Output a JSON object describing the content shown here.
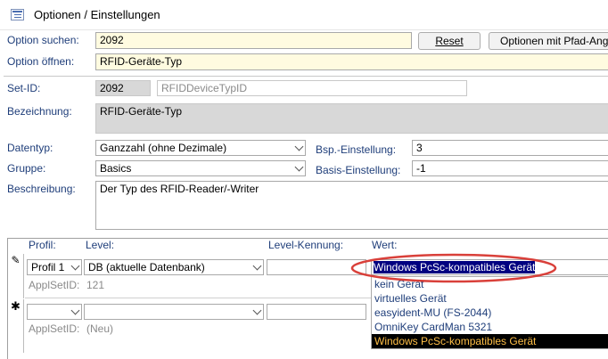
{
  "window": {
    "title": "Optionen / Einstellungen",
    "icon": "form-icon"
  },
  "search": {
    "label": "Option suchen:",
    "value": "2092",
    "reset": "Reset",
    "with_path": "Optionen mit Pfad-Ang"
  },
  "open": {
    "label": "Option öffnen:",
    "value": "RFID-Geräte-Typ"
  },
  "set": {
    "label": "Set-ID:",
    "id": "2092",
    "name": "RFIDDeviceTypID"
  },
  "bezeichnung": {
    "label": "Bezeichnung:",
    "value": "RFID-Geräte-Typ"
  },
  "datentyp": {
    "label": "Datentyp:",
    "value": "Ganzzahl (ohne Dezimale)"
  },
  "bsp": {
    "label": "Bsp.-Einstellung:",
    "value": "3"
  },
  "gruppe": {
    "label": "Gruppe:",
    "value": "Basics"
  },
  "basis": {
    "label": "Basis-Einstellung:",
    "value": "-1"
  },
  "beschreibung": {
    "label": "Beschreibung:",
    "value": "Der Typ des RFID-Reader/-Writer"
  },
  "subform": {
    "headers": {
      "profil": "Profil:",
      "level": "Level:",
      "kennung": "Level-Kennung:",
      "wert": "Wert:"
    },
    "row1": {
      "profil": "Profil 1",
      "level": "DB  (aktuelle Datenbank)",
      "kennung": "",
      "wert": "Windows PcSc-kompatibles Gerät",
      "applset_label": "ApplSetID:",
      "applset_value": "121",
      "marker": "✎"
    },
    "row2": {
      "applset_label": "ApplSetID:",
      "applset_value": "(Neu)",
      "marker": "✱"
    }
  },
  "dropdown": {
    "options": [
      "kein Gerät",
      "virtuelles Gerät",
      "easyident-MU (FS-2044)",
      "OmniKey CardMan 5321",
      "Windows PcSc-kompatibles Gerät"
    ],
    "selected_index": 4
  },
  "annotation": {
    "color": "#d9403a"
  }
}
